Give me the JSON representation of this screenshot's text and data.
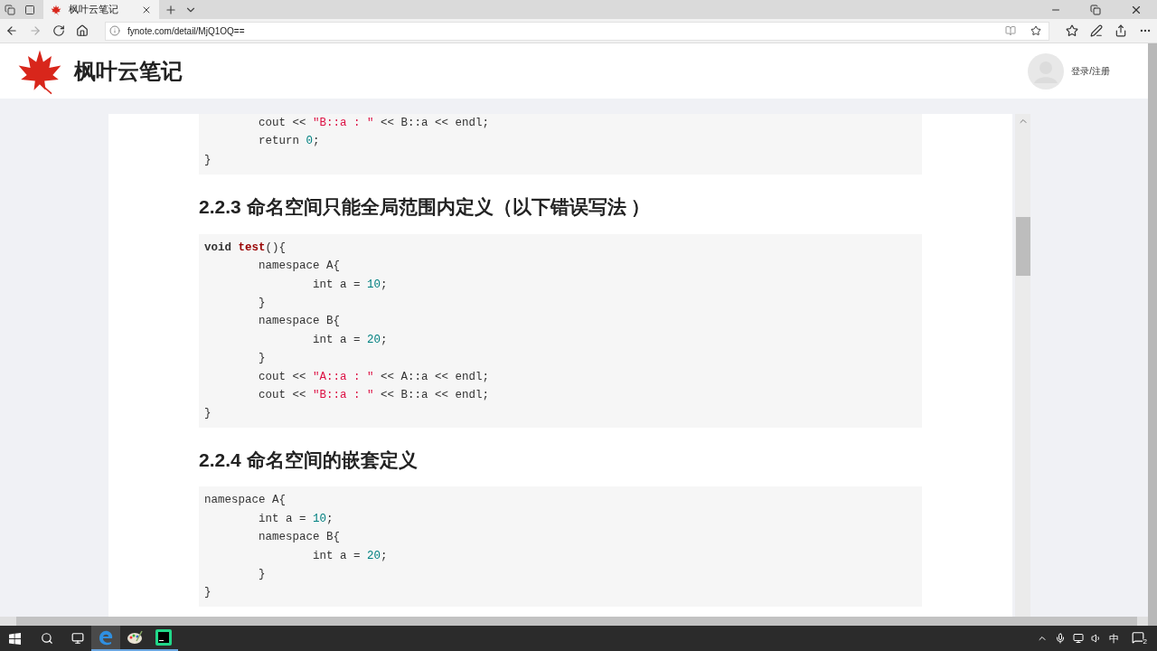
{
  "browser": {
    "tab": {
      "title": "枫叶云笔记",
      "selected": true
    },
    "url": "fynote.com/detail/MjQ1OQ=="
  },
  "site": {
    "name": "枫叶云笔记",
    "login": "登录/注册"
  },
  "blocks": [
    {
      "kind": "code",
      "lines": [
        [
          {
            "kind": "plain",
            "text": "        cout << "
          },
          {
            "kind": "string",
            "text": "\"B::a : \""
          },
          {
            "kind": "plain",
            "text": " << B::a << endl;"
          }
        ],
        [
          {
            "kind": "plain",
            "text": "        return "
          },
          {
            "kind": "number",
            "text": "0"
          },
          {
            "kind": "plain",
            "text": ";"
          }
        ],
        [
          {
            "kind": "plain",
            "text": "}"
          }
        ]
      ]
    },
    {
      "kind": "heading",
      "text": "2.2.3 命名空间只能全局范围内定义（以下错误写法 ）"
    },
    {
      "kind": "code",
      "lines": [
        [
          {
            "kind": "keyword",
            "text": "void "
          },
          {
            "kind": "title",
            "text": "test"
          },
          {
            "kind": "plain",
            "text": "(){"
          }
        ],
        [
          {
            "kind": "plain",
            "text": "        namespace A{"
          }
        ],
        [
          {
            "kind": "plain",
            "text": "                int a = "
          },
          {
            "kind": "number",
            "text": "10"
          },
          {
            "kind": "plain",
            "text": ";"
          }
        ],
        [
          {
            "kind": "plain",
            "text": "        }"
          }
        ],
        [
          {
            "kind": "plain",
            "text": "        namespace B{"
          }
        ],
        [
          {
            "kind": "plain",
            "text": "                int a = "
          },
          {
            "kind": "number",
            "text": "20"
          },
          {
            "kind": "plain",
            "text": ";"
          }
        ],
        [
          {
            "kind": "plain",
            "text": "        }"
          }
        ],
        [
          {
            "kind": "plain",
            "text": "        cout << "
          },
          {
            "kind": "string",
            "text": "\"A::a : \""
          },
          {
            "kind": "plain",
            "text": " << A::a << endl;"
          }
        ],
        [
          {
            "kind": "plain",
            "text": "        cout << "
          },
          {
            "kind": "string",
            "text": "\"B::a : \""
          },
          {
            "kind": "plain",
            "text": " << B::a << endl;"
          }
        ],
        [
          {
            "kind": "plain",
            "text": "}"
          }
        ]
      ]
    },
    {
      "kind": "heading",
      "text": "2.2.4 命名空间的嵌套定义"
    },
    {
      "kind": "code",
      "lines": [
        [
          {
            "kind": "plain",
            "text": "namespace A{"
          }
        ],
        [
          {
            "kind": "plain",
            "text": "        int a = "
          },
          {
            "kind": "number",
            "text": "10"
          },
          {
            "kind": "plain",
            "text": ";"
          }
        ],
        [
          {
            "kind": "plain",
            "text": "        namespace B{"
          }
        ],
        [
          {
            "kind": "plain",
            "text": "                int a = "
          },
          {
            "kind": "number",
            "text": "20"
          },
          {
            "kind": "plain",
            "text": ";"
          }
        ],
        [
          {
            "kind": "plain",
            "text": "        }"
          }
        ],
        [
          {
            "kind": "plain",
            "text": "}"
          }
        ]
      ]
    }
  ],
  "taskbar": {
    "apps": [
      {
        "kind": "edge",
        "selected": true
      },
      {
        "kind": "paint",
        "selected": false
      },
      {
        "kind": "ide",
        "selected": false
      }
    ],
    "ime": "中",
    "notifications": "2"
  }
}
